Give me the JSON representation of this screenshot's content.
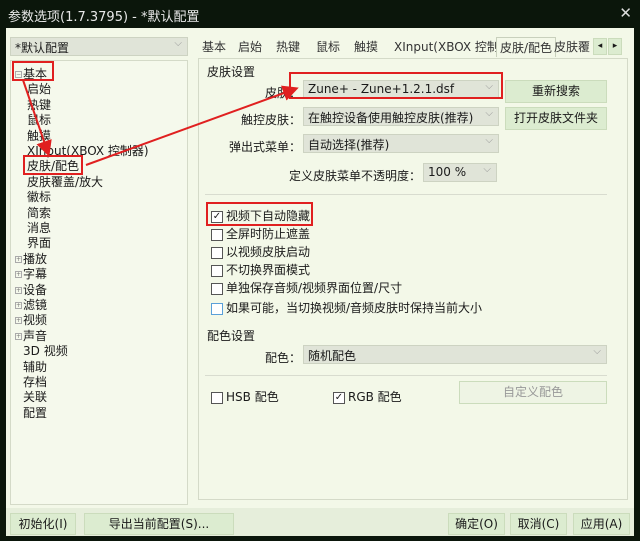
{
  "window": {
    "title": "参数选项(1.7.3795) - *默认配置",
    "close": "✕"
  },
  "profile": {
    "value": "*默认配置"
  },
  "tree": [
    {
      "label": "基本",
      "expander": "−"
    },
    {
      "label": "启始"
    },
    {
      "label": "热键"
    },
    {
      "label": "鼠标"
    },
    {
      "label": "触摸"
    },
    {
      "label": "XInput(XBOX 控制器)"
    },
    {
      "label": "皮肤/配色"
    },
    {
      "label": "皮肤覆盖/放大"
    },
    {
      "label": "徽标"
    },
    {
      "label": "简索"
    },
    {
      "label": "消息"
    },
    {
      "label": "界面"
    },
    {
      "label": "播放",
      "expander": "+"
    },
    {
      "label": "字幕",
      "expander": "+"
    },
    {
      "label": "设备",
      "expander": "+"
    },
    {
      "label": "滤镜",
      "expander": "+"
    },
    {
      "label": "视频",
      "expander": "+"
    },
    {
      "label": "声音",
      "expander": "+"
    },
    {
      "label": "3D 视频"
    },
    {
      "label": "辅助"
    },
    {
      "label": "存档"
    },
    {
      "label": "关联"
    },
    {
      "label": "配置"
    }
  ],
  "tabs": [
    "基本",
    "启始",
    "热键",
    "鼠标",
    "触摸",
    "XInput(XBOX 控制器)",
    "皮肤/配色",
    "皮肤覆"
  ],
  "tab_scroll": {
    "left": "◂",
    "right": "▸"
  },
  "skin": {
    "group": "皮肤设置",
    "skin_label": "皮肤：",
    "skin_value": "Zune+ - Zune+1.2.1.dsf",
    "rescan": "重新搜索",
    "touch_label": "触控皮肤：",
    "touch_value": "在触控设备使用触控皮肤(推荐)",
    "open_folder": "打开皮肤文件夹",
    "popup_label": "弹出式菜单：",
    "popup_value": "自动选择(推荐)",
    "opacity_label": "定义皮肤菜单不透明度：",
    "opacity_value": "100 %",
    "checks": [
      {
        "label": "视频下自动隐藏",
        "checked": true
      },
      {
        "label": "全屏时防止遮盖",
        "checked": false
      },
      {
        "label": "以视频皮肤启动",
        "checked": false
      },
      {
        "label": "不切换界面模式",
        "checked": false
      },
      {
        "label": "单独保存音频/视频界面位置/尺寸",
        "checked": false
      },
      {
        "label": "如果可能，当切换视频/音频皮肤时保持当前大小",
        "checked": false
      }
    ]
  },
  "color": {
    "group": "配色设置",
    "label": "配色：",
    "value": "随机配色",
    "hsb": "HSB 配色",
    "hsb_checked": false,
    "rgb": "RGB 配色",
    "rgb_checked": true,
    "custom": "自定义配色"
  },
  "buttons": {
    "init": "初始化(I)",
    "export": "导出当前配置(S)...",
    "ok": "确定(O)",
    "cancel": "取消(C)",
    "apply": "应用(A)"
  },
  "annotation_color": "#e02020"
}
